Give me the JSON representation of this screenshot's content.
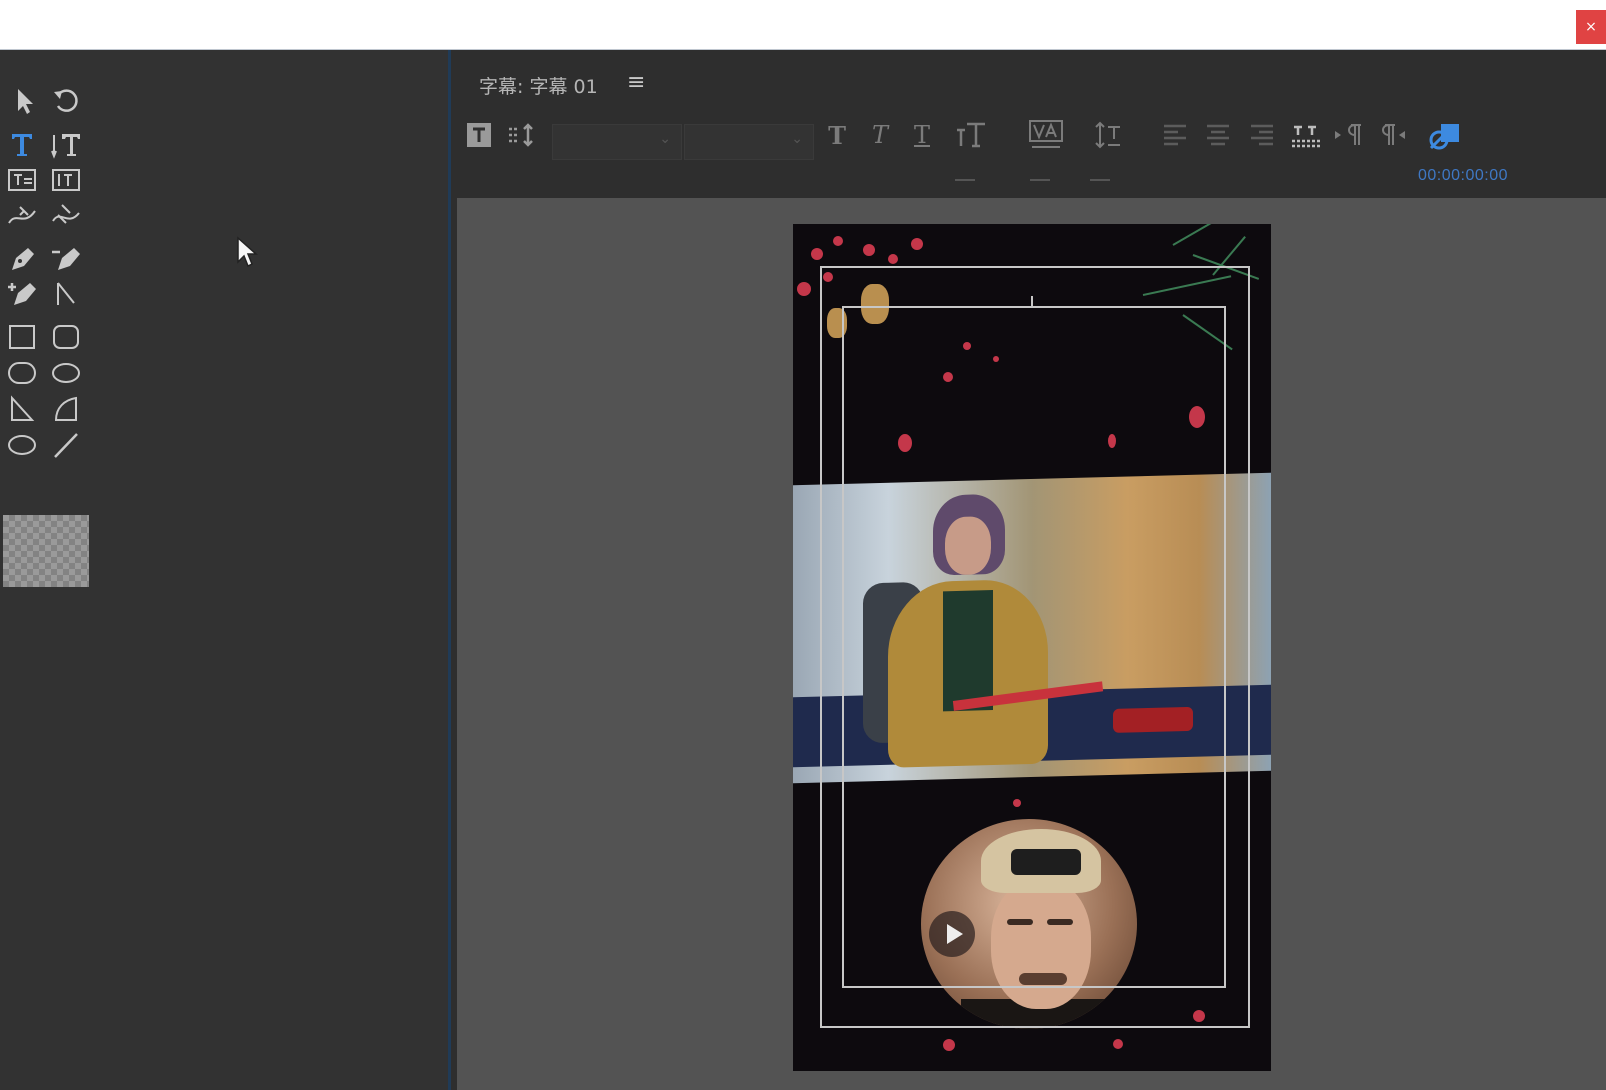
{
  "window": {
    "close_glyph": "×",
    "close_color": "#e04343"
  },
  "tools": {
    "items": [
      {
        "name": "selection-tool",
        "icon": "arrow-cursor-icon"
      },
      {
        "name": "rotation-tool",
        "icon": "rotate-icon"
      },
      {
        "name": "type-tool",
        "icon": "horizontal-type-icon",
        "active": true
      },
      {
        "name": "vertical-type-tool",
        "icon": "vertical-type-icon"
      },
      {
        "name": "area-type-tool",
        "icon": "area-type-icon"
      },
      {
        "name": "vertical-area-type-tool",
        "icon": "vertical-area-type-icon"
      },
      {
        "name": "path-type-tool",
        "icon": "path-type-icon"
      },
      {
        "name": "vertical-path-type-tool",
        "icon": "vertical-path-type-icon"
      },
      {
        "name": "pen-tool",
        "icon": "pen-icon"
      },
      {
        "name": "delete-anchor-tool",
        "icon": "pen-minus-icon"
      },
      {
        "name": "add-anchor-tool",
        "icon": "pen-plus-icon"
      },
      {
        "name": "convert-anchor-tool",
        "icon": "convert-anchor-icon"
      },
      {
        "name": "rectangle-tool",
        "icon": "rectangle-icon"
      },
      {
        "name": "rounded-rectangle-tool",
        "icon": "rounded-rectangle-icon"
      },
      {
        "name": "clipped-rectangle-tool",
        "icon": "clipped-rectangle-icon"
      },
      {
        "name": "rounded-corner-tool",
        "icon": "rounded-corner-icon"
      },
      {
        "name": "wedge-tool",
        "icon": "wedge-icon"
      },
      {
        "name": "arc-tool",
        "icon": "arc-icon"
      },
      {
        "name": "ellipse-tool",
        "icon": "ellipse-icon"
      },
      {
        "name": "line-tool",
        "icon": "line-icon"
      }
    ],
    "accent_color": "#3d8ae0"
  },
  "title_panel": {
    "title": "字幕: 字幕 01",
    "menu_glyph": "≡",
    "timecode": "00:00:00:00",
    "timecode_color": "#3f78c4",
    "toolbar_icons": [
      "roll-crawl-icon",
      "tab-stops-icon",
      "font-family-dropdown",
      "font-style-dropdown",
      "bold-icon",
      "italic-icon",
      "underline-icon",
      "font-size-icon",
      "kerning-icon",
      "leading-icon",
      "align-left-icon",
      "align-center-icon",
      "align-right-icon",
      "tab-icon",
      "text-direction-left-icon",
      "text-direction-right-icon",
      "show-background-video-icon"
    ]
  }
}
